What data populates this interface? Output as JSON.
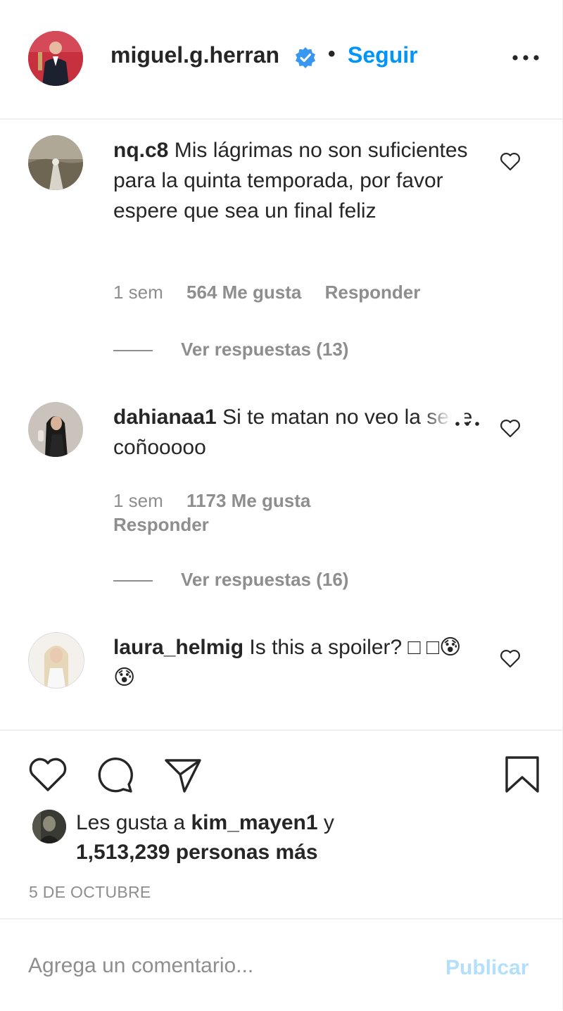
{
  "header": {
    "username": "miguel.g.herran",
    "separator": "•",
    "follow_label": "Seguir"
  },
  "comments": [
    {
      "username": "nq.c8",
      "text": "Mis lágrimas no son suficientes para la quinta temporada, por favor espere que sea un final feliz",
      "time": "1 sem",
      "likes": "564 Me gusta",
      "reply_label": "Responder",
      "view_replies": "Ver respuestas (13)"
    },
    {
      "username": "dahianaa1",
      "text": "Si te matan no veo la serie coñooooo",
      "time": "1 sem",
      "likes": "1173 Me gusta",
      "reply_label": "Responder",
      "view_replies": "Ver respuestas (16)"
    },
    {
      "username": "laura_helmig",
      "text": "Is this a spoiler? □ □😰😰"
    }
  ],
  "likes": {
    "prefix": "Les gusta a ",
    "user": "kim_mayen1",
    "conjunction": " y",
    "others": "1,513,239 personas más"
  },
  "post_date": "5 DE OCTUBRE",
  "comment_box": {
    "placeholder": "Agrega un comentario...",
    "value": "",
    "publish_label": "Publicar"
  },
  "icons": {
    "verified": "verified-badge-icon",
    "more": "more-options-icon",
    "like": "heart-icon",
    "comment": "comment-icon",
    "share": "paper-plane-icon",
    "save": "bookmark-icon"
  },
  "colors": {
    "accent": "#0095f6",
    "publish_disabled": "#b2dffc",
    "text": "#262626",
    "muted": "#8e8e8e",
    "divider": "#efefef"
  }
}
